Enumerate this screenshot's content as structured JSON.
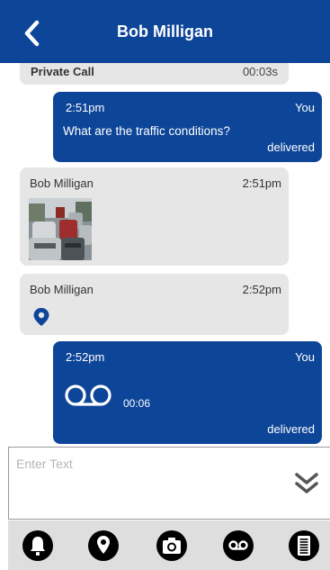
{
  "header": {
    "title": "Bob Milligan",
    "back_icon": "chevron-left-icon"
  },
  "colors": {
    "brand": "#0d4598",
    "incoming_bubble": "#e6e6e6",
    "toolbar": "#dedede"
  },
  "messages": [
    {
      "type": "call",
      "direction": "incoming",
      "label": "Private Call",
      "duration": "00:03s"
    },
    {
      "type": "text",
      "direction": "outgoing",
      "time": "2:51pm",
      "sender": "You",
      "text": "What are the traffic conditions?",
      "status": "delivered"
    },
    {
      "type": "image",
      "direction": "incoming",
      "sender": "Bob Milligan",
      "time": "2:51pm",
      "image": "traffic-photo"
    },
    {
      "type": "location",
      "direction": "incoming",
      "sender": "Bob Milligan",
      "time": "2:52pm",
      "icon": "location-pin-icon"
    },
    {
      "type": "voicemail",
      "direction": "outgoing",
      "time": "2:52pm",
      "sender": "You",
      "duration": "00:06",
      "status": "delivered",
      "icon": "voicemail-icon"
    }
  ],
  "composer": {
    "placeholder": "Enter Text",
    "value": "",
    "expand_icon": "double-chevron-down-icon"
  },
  "toolbar": {
    "items": [
      {
        "name": "emergency-alert-icon"
      },
      {
        "name": "location-icon"
      },
      {
        "name": "camera-icon"
      },
      {
        "name": "voicemail-icon"
      },
      {
        "name": "document-icon"
      }
    ]
  }
}
